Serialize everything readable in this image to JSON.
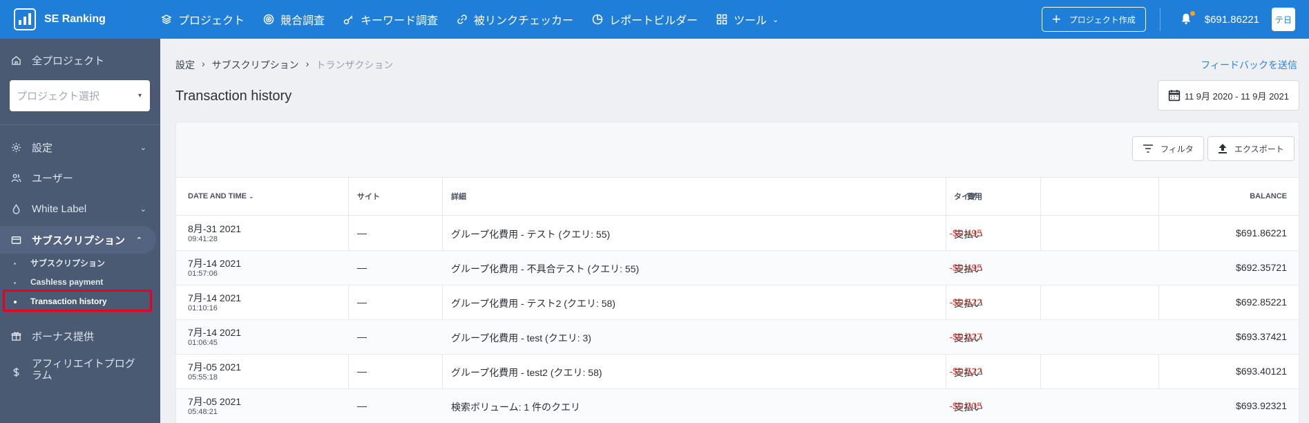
{
  "topbar": {
    "brand": "SE Ranking",
    "nav": [
      {
        "label": "プロジェクト",
        "icon": "layers-icon"
      },
      {
        "label": "競合調査",
        "icon": "target-icon"
      },
      {
        "label": "キーワード調査",
        "icon": "key-icon"
      },
      {
        "label": "被リンクチェッカー",
        "icon": "link-icon"
      },
      {
        "label": "レポートビルダー",
        "icon": "pie-icon"
      },
      {
        "label": "ツール",
        "icon": "grid-icon"
      }
    ],
    "create_label": "プロジェクト作成",
    "balance": "$691.86221",
    "avatar": "テ日"
  },
  "sidebar": {
    "all_projects": "全プロジェクト",
    "project_select_placeholder": "プロジェクト選択",
    "settings": "設定",
    "users": "ユーザー",
    "white_label": "White Label",
    "subscription": "サブスクリプション",
    "sub_items": [
      "サブスクリプション",
      "Cashless payment",
      "Transaction history"
    ],
    "bonus": "ボーナス提供",
    "affiliate": "アフィリエイトプログラム"
  },
  "main": {
    "breadcrumb": [
      "設定",
      "サブスクリプション",
      "トランザクション"
    ],
    "breadcrumb_sep": "›",
    "feedback": "フィードバックを送信",
    "title": "Transaction history",
    "date_range": "11 9月 2020 - 11 9月 2021",
    "filter_label": "フィルタ",
    "export_label": "エクスポート",
    "columns": {
      "date": "DATE AND TIME",
      "site": "サイト",
      "details": "詳細",
      "type": "タイプ",
      "cost": "費用",
      "balance": "BALANCE"
    },
    "rows": [
      {
        "date": "8月-31 2021",
        "time": "09:41:28",
        "site": "—",
        "details": "グループ化費用 - テスト (クエリ: 55)",
        "type": "支払い",
        "cost": "-$0.495",
        "balance": "$691.86221"
      },
      {
        "date": "7月-14 2021",
        "time": "01:57:06",
        "site": "—",
        "details": "グループ化費用 - 不具合テスト (クエリ: 55)",
        "type": "支払い",
        "cost": "-$0.495",
        "balance": "$692.35721"
      },
      {
        "date": "7月-14 2021",
        "time": "01:10:16",
        "site": "—",
        "details": "グループ化費用 - テスト2 (クエリ: 58)",
        "type": "支払い",
        "cost": "-$0.522",
        "balance": "$692.85221"
      },
      {
        "date": "7月-14 2021",
        "time": "01:06:45",
        "site": "—",
        "details": "グループ化費用 - test (クエリ: 3)",
        "type": "支払い",
        "cost": "-$0.027",
        "balance": "$693.37421"
      },
      {
        "date": "7月-05 2021",
        "time": "05:55:18",
        "site": "—",
        "details": "グループ化費用 - test2 (クエリ: 58)",
        "type": "支払い",
        "cost": "-$0.522",
        "balance": "$693.40121"
      },
      {
        "date": "7月-05 2021",
        "time": "05:48:21",
        "site": "—",
        "details": "検索ボリューム: 1 件のクエリ",
        "type": "支払い",
        "cost": "-$0.005",
        "balance": "$693.92321"
      }
    ]
  },
  "colors": {
    "topbar": "#1f7ed8",
    "sidebar": "#4a5a72",
    "cost_negative": "#e33a2f",
    "link": "#2b84de",
    "highlight": "#e8001c"
  }
}
